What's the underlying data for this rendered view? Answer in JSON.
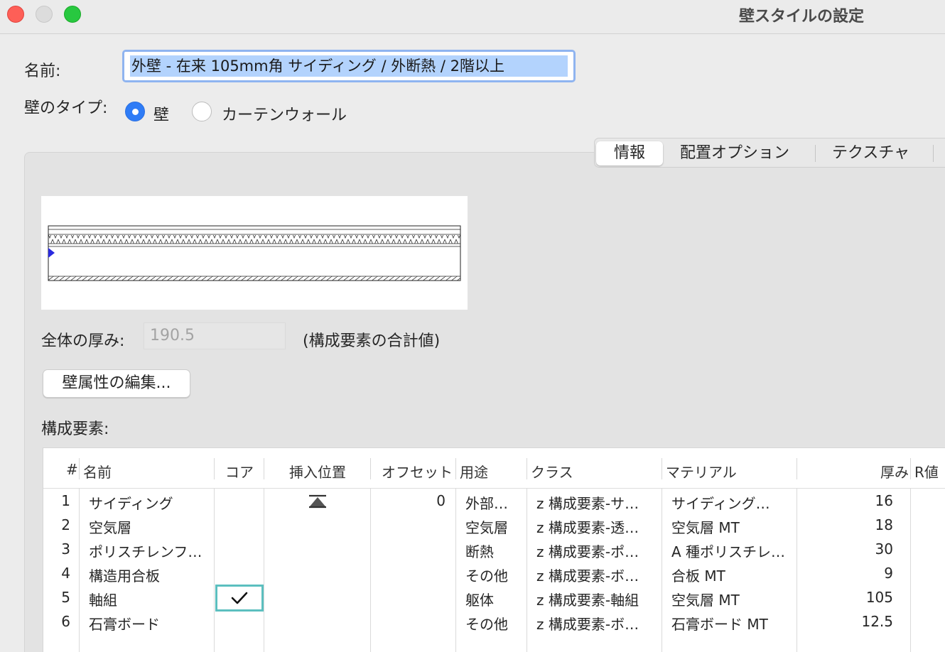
{
  "window": {
    "title": "壁スタイルの設定"
  },
  "form": {
    "name_label": "名前:",
    "name_value": "外壁 - 在来 105mm角 サイディング / 外断熱 / 2階以上",
    "type_label": "壁のタイプ:",
    "type_option_wall": "壁",
    "type_option_curtain": "カーテンウォール",
    "type_selected": "壁"
  },
  "tabs": [
    {
      "label": "情報",
      "active": true
    },
    {
      "label": "配置オプション",
      "active": false
    },
    {
      "label": "テクスチャ",
      "active": false
    }
  ],
  "thickness": {
    "label": "全体の厚み:",
    "value": "190.5",
    "note": "(構成要素の合計値)"
  },
  "edit_button": "壁属性の編集...",
  "components_label": "構成要素:",
  "table": {
    "headers": [
      "#",
      "名前",
      "コア",
      "挿入位置",
      "オフセット",
      "用途",
      "クラス",
      "マテリアル",
      "厚み",
      "R値"
    ],
    "rows": [
      {
        "num": "1",
        "name": "サイディング",
        "core": false,
        "offset": "0",
        "use": "外部…",
        "cls": "z 構成要素-サ…",
        "material": "サイディング…",
        "thick": "16"
      },
      {
        "num": "2",
        "name": "空気層",
        "core": false,
        "offset": "",
        "use": "空気層",
        "cls": "z 構成要素-透…",
        "material": "空気層 MT",
        "thick": "18"
      },
      {
        "num": "3",
        "name": "ポリスチレンフ…",
        "core": false,
        "offset": "",
        "use": "断熱",
        "cls": "z 構成要素-ポ…",
        "material": "A 種ポリスチレ…",
        "thick": "30"
      },
      {
        "num": "4",
        "name": "構造用合板",
        "core": false,
        "offset": "",
        "use": "その他",
        "cls": "z 構成要素-ボ…",
        "material": "合板 MT",
        "thick": "9"
      },
      {
        "num": "5",
        "name": "軸組",
        "core": true,
        "offset": "",
        "use": "躯体",
        "cls": "z 構成要素-軸組",
        "material": "空気層 MT",
        "thick": "105"
      },
      {
        "num": "6",
        "name": "石膏ボード",
        "core": false,
        "offset": "",
        "use": "その他",
        "cls": "z 構成要素-ボ…",
        "material": "石膏ボード MT",
        "thick": "12.5"
      }
    ],
    "check_glyph": "✓"
  },
  "colors": {
    "accent": "#2f7cf6",
    "selection": "#b3d3fd",
    "focus_ring": "#5cbfbf"
  }
}
